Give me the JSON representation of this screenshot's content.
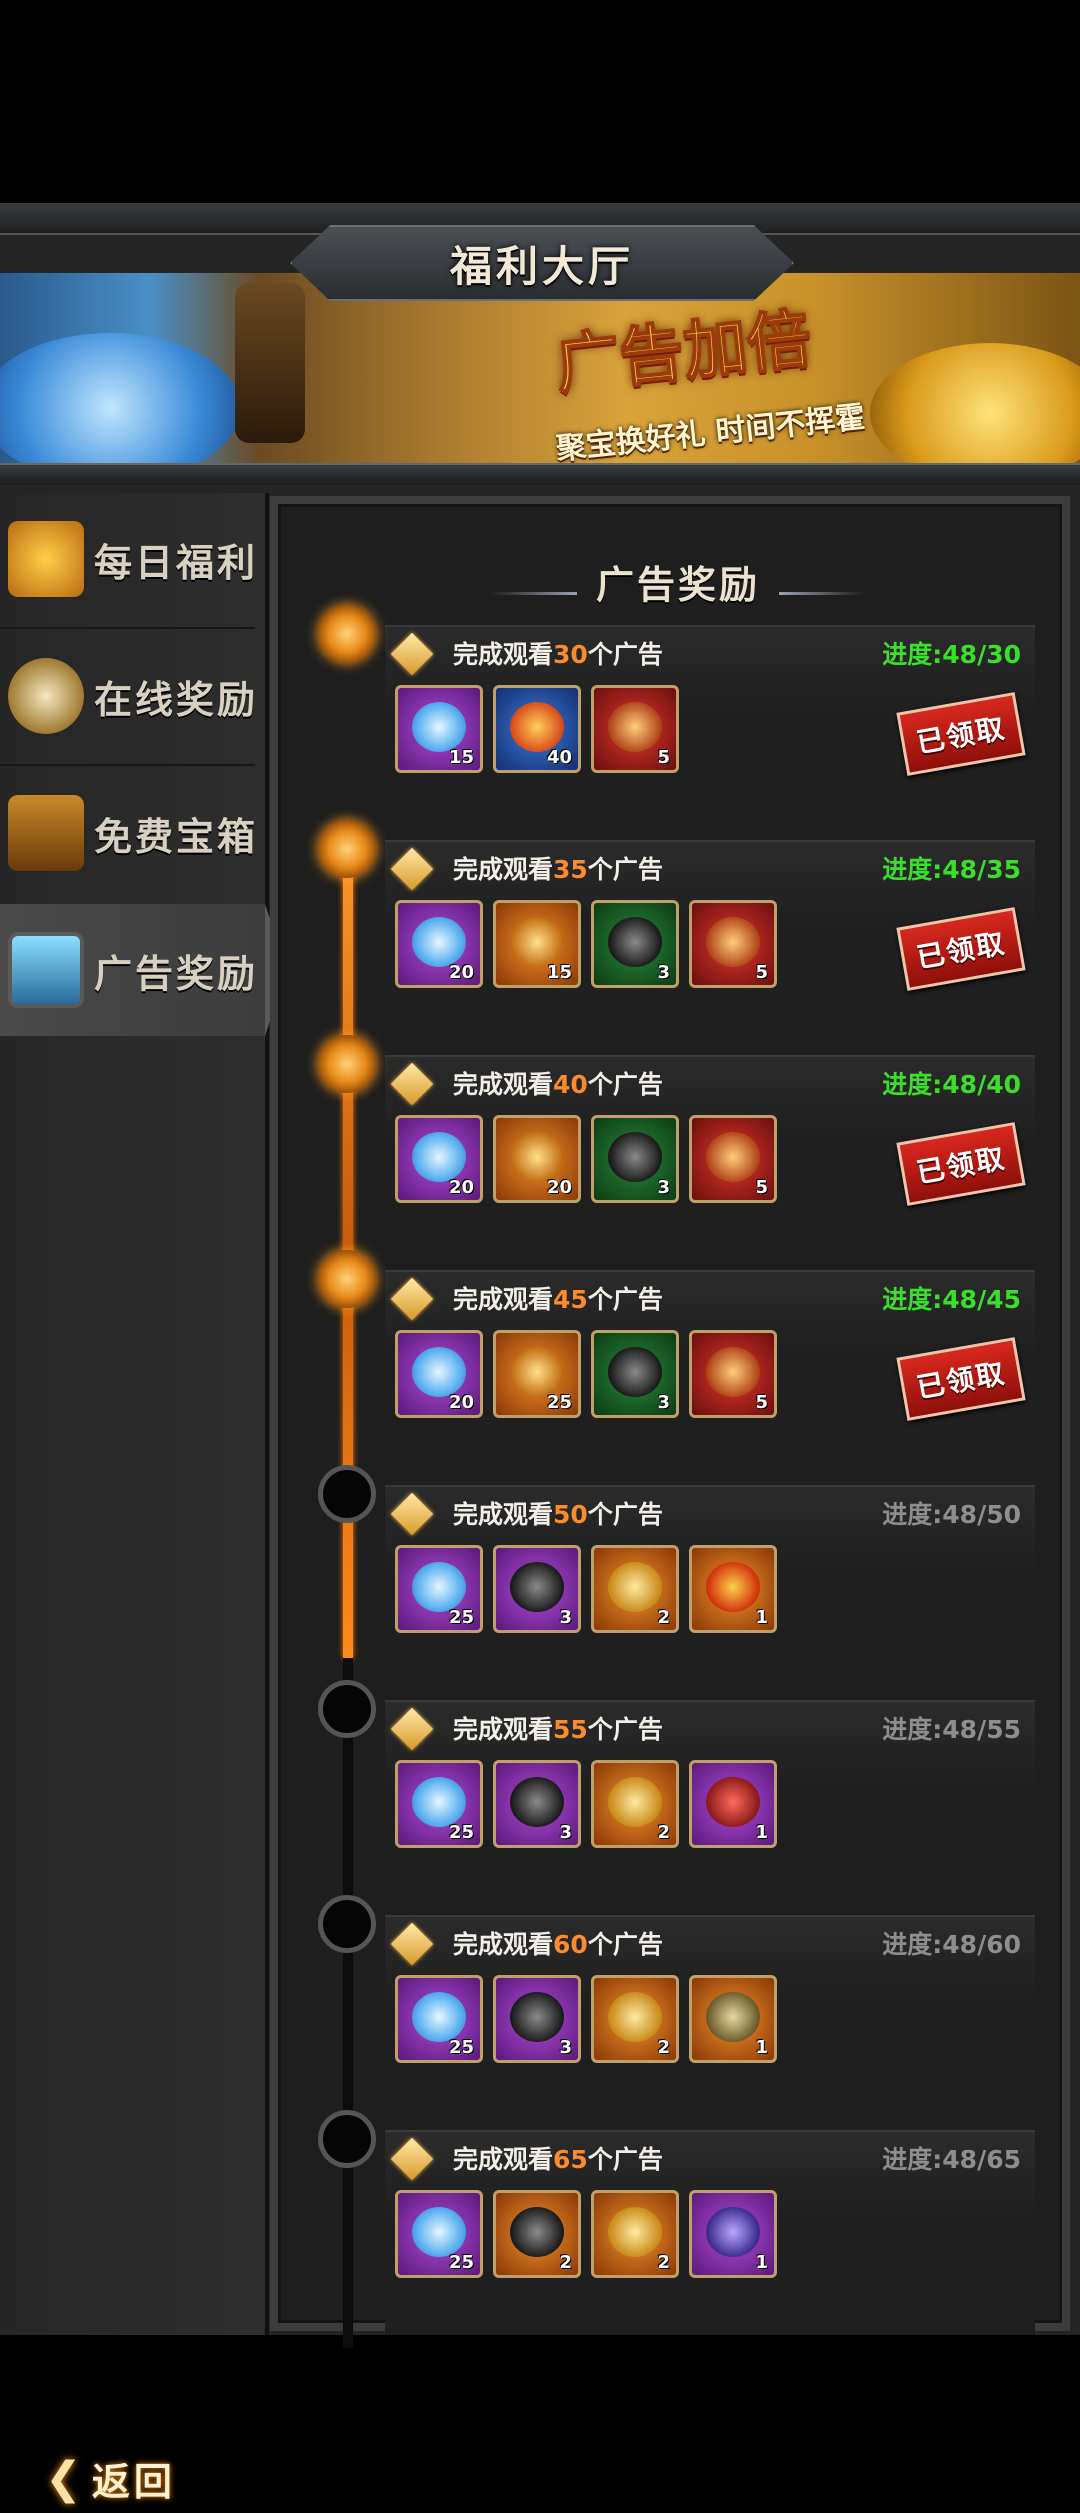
{
  "header": {
    "title": "福利大厅",
    "banner_headline": "广告加倍",
    "banner_slogan": "聚宝换好礼  时间不挥霍"
  },
  "sidebar": {
    "items": [
      {
        "label": "每日福利",
        "icon": "gift-bag-icon"
      },
      {
        "label": "在线奖励",
        "icon": "pocket-watch-icon"
      },
      {
        "label": "免费宝箱",
        "icon": "treasure-chest-icon"
      },
      {
        "label": "广告奖励",
        "icon": "tv-icon",
        "active": true
      }
    ],
    "back_label": "返回"
  },
  "panel": {
    "title": "广告奖励",
    "claimed_label": "已领取",
    "tasks": [
      {
        "prefix": "完成观看",
        "count": "30",
        "suffix": "个广告",
        "progress": "进度:48/30",
        "done": true,
        "rewards": [
          {
            "icon": "diamond-pile-icon",
            "qty": "15",
            "color": "purple"
          },
          {
            "icon": "exp-orb-icon",
            "qty": "40",
            "color": "blue"
          },
          {
            "icon": "gem-bag-icon",
            "qty": "5",
            "color": "red"
          }
        ]
      },
      {
        "prefix": "完成观看",
        "count": "35",
        "suffix": "个广告",
        "progress": "进度:48/35",
        "done": true,
        "rewards": [
          {
            "icon": "diamond-pile-icon",
            "qty": "20",
            "color": "purple"
          },
          {
            "icon": "coin-bag-icon",
            "qty": "15",
            "color": "orange"
          },
          {
            "icon": "mystery-token-icon",
            "qty": "3",
            "color": "green"
          },
          {
            "icon": "gem-bag-icon",
            "qty": "5",
            "color": "red"
          }
        ]
      },
      {
        "prefix": "完成观看",
        "count": "40",
        "suffix": "个广告",
        "progress": "进度:48/40",
        "done": true,
        "rewards": [
          {
            "icon": "diamond-pile-icon",
            "qty": "20",
            "color": "purple"
          },
          {
            "icon": "coin-bag-icon",
            "qty": "20",
            "color": "orange"
          },
          {
            "icon": "mystery-token-icon",
            "qty": "3",
            "color": "green"
          },
          {
            "icon": "gem-bag-icon",
            "qty": "5",
            "color": "red"
          }
        ]
      },
      {
        "prefix": "完成观看",
        "count": "45",
        "suffix": "个广告",
        "progress": "进度:48/45",
        "done": true,
        "rewards": [
          {
            "icon": "diamond-pile-icon",
            "qty": "20",
            "color": "purple"
          },
          {
            "icon": "coin-bag-icon",
            "qty": "25",
            "color": "orange"
          },
          {
            "icon": "mystery-token-icon",
            "qty": "3",
            "color": "green"
          },
          {
            "icon": "gem-bag-icon",
            "qty": "5",
            "color": "red"
          }
        ]
      },
      {
        "prefix": "完成观看",
        "count": "50",
        "suffix": "个广告",
        "progress": "进度:48/50",
        "done": false,
        "rewards": [
          {
            "icon": "diamond-pile-icon",
            "qty": "25",
            "color": "purple"
          },
          {
            "icon": "mystery-token-icon",
            "qty": "3",
            "color": "purple"
          },
          {
            "icon": "ankh-coin-icon",
            "qty": "2",
            "color": "orange"
          },
          {
            "icon": "fire-eye-icon",
            "qty": "1",
            "color": "orange"
          }
        ]
      },
      {
        "prefix": "完成观看",
        "count": "55",
        "suffix": "个广告",
        "progress": "进度:48/55",
        "done": false,
        "rewards": [
          {
            "icon": "diamond-pile-icon",
            "qty": "25",
            "color": "purple"
          },
          {
            "icon": "mystery-token-icon",
            "qty": "3",
            "color": "purple"
          },
          {
            "icon": "ankh-coin-icon",
            "qty": "2",
            "color": "orange"
          },
          {
            "icon": "scroll-icon",
            "qty": "1",
            "color": "purple"
          }
        ]
      },
      {
        "prefix": "完成观看",
        "count": "60",
        "suffix": "个广告",
        "progress": "进度:48/60",
        "done": false,
        "rewards": [
          {
            "icon": "diamond-pile-icon",
            "qty": "25",
            "color": "purple"
          },
          {
            "icon": "mystery-token-icon",
            "qty": "3",
            "color": "purple"
          },
          {
            "icon": "ankh-coin-icon",
            "qty": "2",
            "color": "orange"
          },
          {
            "icon": "skull-emblem-icon",
            "qty": "1",
            "color": "orange"
          }
        ]
      },
      {
        "prefix": "完成观看",
        "count": "65",
        "suffix": "个广告",
        "progress": "进度:48/65",
        "done": false,
        "rewards": [
          {
            "icon": "diamond-pile-icon",
            "qty": "25",
            "color": "purple"
          },
          {
            "icon": "mystery-token-icon",
            "qty": "2",
            "color": "orange"
          },
          {
            "icon": "ankh-coin-icon",
            "qty": "2",
            "color": "orange"
          },
          {
            "icon": "spirit-figure-icon",
            "qty": "1",
            "color": "purple"
          }
        ]
      }
    ]
  },
  "colors": {
    "progress_done": "#3adf2a",
    "progress_pending": "#8e8e8e",
    "count_highlight": "#ff8a2a",
    "stamp_red": "#d8271e"
  }
}
